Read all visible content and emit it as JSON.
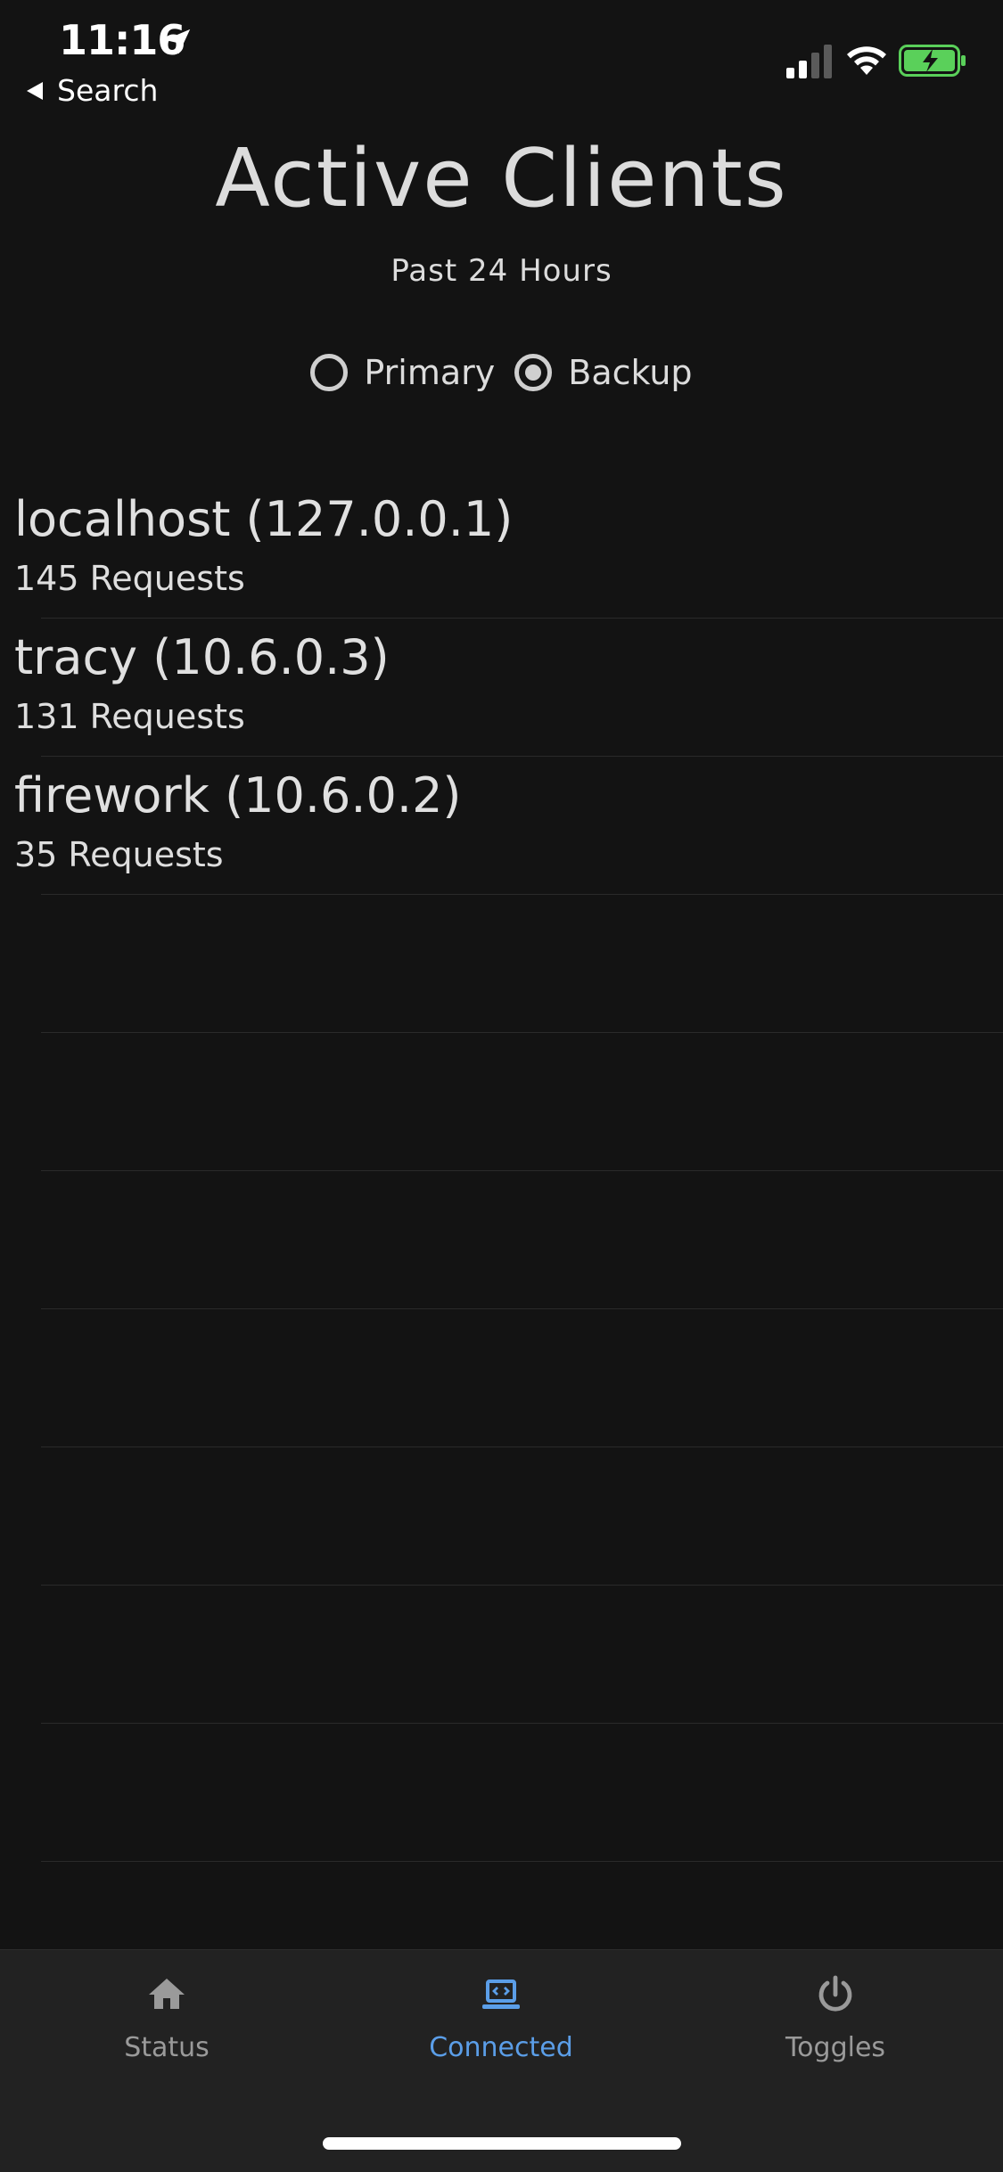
{
  "status_bar": {
    "time": "11:16",
    "back_label": "Search"
  },
  "header": {
    "title": "Active Clients",
    "subtitle": "Past 24 Hours"
  },
  "server_selector": {
    "options": [
      {
        "label": "Primary",
        "selected": false
      },
      {
        "label": "Backup",
        "selected": true
      }
    ]
  },
  "clients": [
    {
      "name": "localhost (127.0.0.1)",
      "requests": "145 Requests"
    },
    {
      "name": "tracy (10.6.0.3)",
      "requests": "131 Requests"
    },
    {
      "name": "firework (10.6.0.2)",
      "requests": "35 Requests"
    }
  ],
  "tabs": [
    {
      "label": "Status",
      "icon": "home-icon",
      "active": false
    },
    {
      "label": "Connected",
      "icon": "laptop-icon",
      "active": true
    },
    {
      "label": "Toggles",
      "icon": "power-icon",
      "active": false
    }
  ],
  "colors": {
    "background": "#131313",
    "tab_bar": "#222222",
    "active_tab": "#5b9ee8",
    "inactive_tab": "#9a9a9a",
    "battery_fill": "#5ad05a"
  }
}
